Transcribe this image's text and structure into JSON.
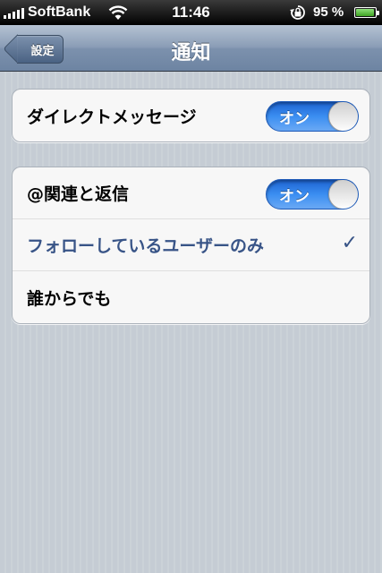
{
  "status_bar": {
    "carrier": "SoftBank",
    "time": "11:46",
    "battery_text": "95 %",
    "battery_level": 0.95,
    "icons": [
      "signal-icon",
      "wifi-icon",
      "rotation-lock-icon",
      "battery-icon"
    ]
  },
  "nav": {
    "back_label": "設定",
    "title": "通知"
  },
  "group1": {
    "direct_message": {
      "label": "ダイレクトメッセージ",
      "toggle": "オン",
      "on": true
    }
  },
  "group2": {
    "mentions": {
      "label": "@関連と返信",
      "toggle": "オン",
      "on": true
    },
    "options": [
      {
        "label": "フォローしているユーザーのみ",
        "selected": true,
        "check": "✓"
      },
      {
        "label": "誰からでも",
        "selected": false
      }
    ]
  },
  "colors": {
    "nav_bar": "#7c91ad",
    "toggle_on": "#3b8ef1",
    "selected_text": "#385487",
    "background": "#c5ccd4"
  }
}
